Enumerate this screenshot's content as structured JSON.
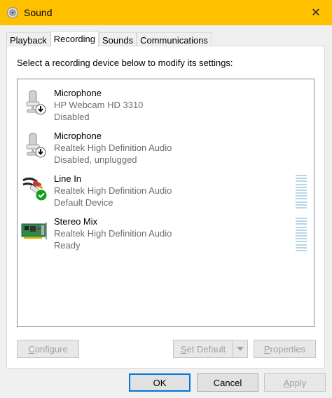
{
  "window": {
    "title": "Sound",
    "close_glyph": "✕"
  },
  "tabs": [
    {
      "label": "Playback"
    },
    {
      "label": "Recording"
    },
    {
      "label": "Sounds"
    },
    {
      "label": "Communications"
    }
  ],
  "instruction": "Select a recording device below to modify its settings:",
  "devices": [
    {
      "name": "Microphone",
      "driver": "HP Webcam HD 3310",
      "status": "Disabled",
      "icon": "microphone-disabled-icon"
    },
    {
      "name": "Microphone",
      "driver": "Realtek High Definition Audio",
      "status": "Disabled, unplugged",
      "icon": "microphone-disabled-icon"
    },
    {
      "name": "Line In",
      "driver": "Realtek High Definition Audio",
      "status": "Default Device",
      "icon": "line-in-default-icon"
    },
    {
      "name": "Stereo Mix",
      "driver": "Realtek High Definition Audio",
      "status": "Ready",
      "icon": "sound-card-icon"
    }
  ],
  "buttons": {
    "configure": {
      "first": "C",
      "rest": "onfigure"
    },
    "set_default": {
      "first": "S",
      "rest": "et Default"
    },
    "properties": {
      "first": "P",
      "rest": "roperties"
    },
    "ok": "OK",
    "cancel": "Cancel",
    "apply": {
      "first": "A",
      "rest": "pply"
    }
  },
  "colors": {
    "titlebar": "#ffc000",
    "focus": "#0078d7",
    "meter": "#b7d7e8",
    "check": "#10a020"
  }
}
